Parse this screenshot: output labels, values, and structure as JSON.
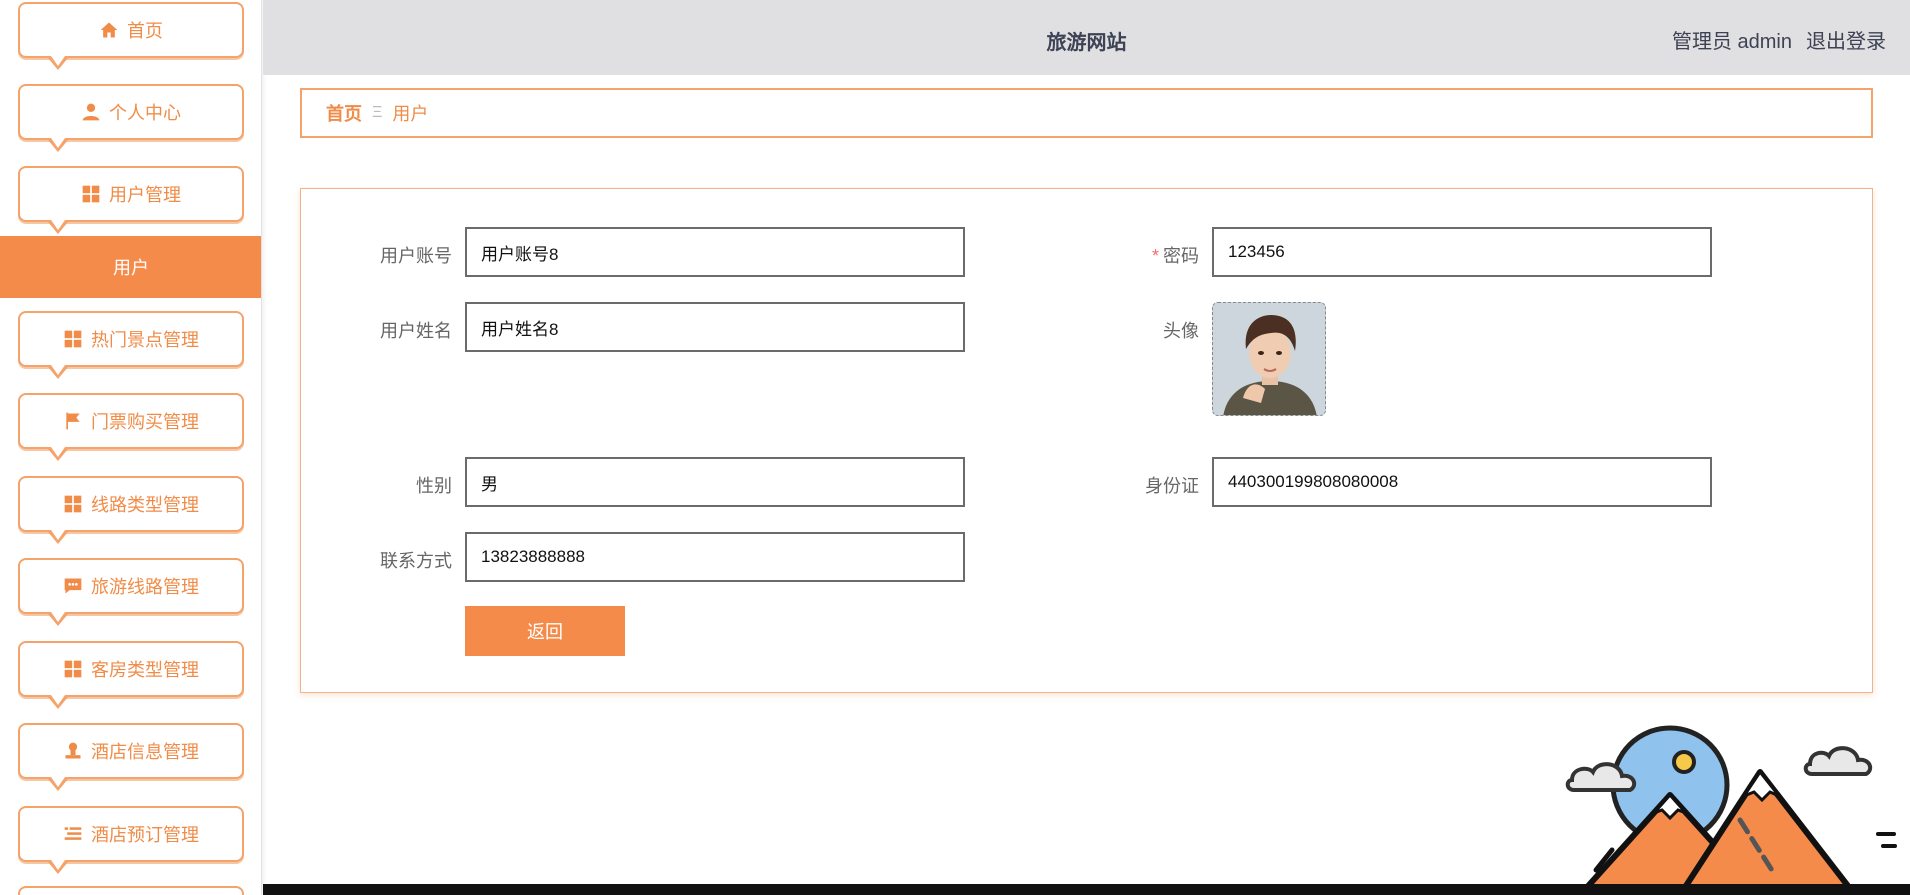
{
  "sidebar": {
    "items": [
      {
        "label": "首页",
        "icon": "home-icon"
      },
      {
        "label": "个人中心",
        "icon": "user-icon"
      },
      {
        "label": "用户管理",
        "icon": "grid-icon"
      },
      {
        "label": "热门景点管理",
        "icon": "grid-icon"
      },
      {
        "label": "门票购买管理",
        "icon": "flag-icon"
      },
      {
        "label": "线路类型管理",
        "icon": "grid-icon"
      },
      {
        "label": "旅游线路管理",
        "icon": "chat-icon"
      },
      {
        "label": "客房类型管理",
        "icon": "grid-icon"
      },
      {
        "label": "酒店信息管理",
        "icon": "stamp-icon"
      },
      {
        "label": "酒店预订管理",
        "icon": "list-icon"
      }
    ],
    "active_sub": "用户"
  },
  "header": {
    "title": "旅游网站",
    "user_label": "管理员 admin",
    "logout_label": "退出登录"
  },
  "breadcrumb": {
    "home": "首页",
    "separator": "Ξ",
    "current": "用户"
  },
  "form": {
    "account_label": "用户账号",
    "account_value": "用户账号8",
    "password_required": "*",
    "password_label": "密码",
    "password_value": "123456",
    "name_label": "用户姓名",
    "name_value": "用户姓名8",
    "avatar_label": "头像",
    "gender_label": "性别",
    "gender_value": "男",
    "idcard_label": "身份证",
    "idcard_value": "440300199808080008",
    "contact_label": "联系方式",
    "contact_value": "13823888888",
    "back_label": "返回"
  },
  "colors": {
    "accent": "#f58b4b",
    "border": "#f4a36b",
    "header_bg": "#e0dfe1"
  }
}
